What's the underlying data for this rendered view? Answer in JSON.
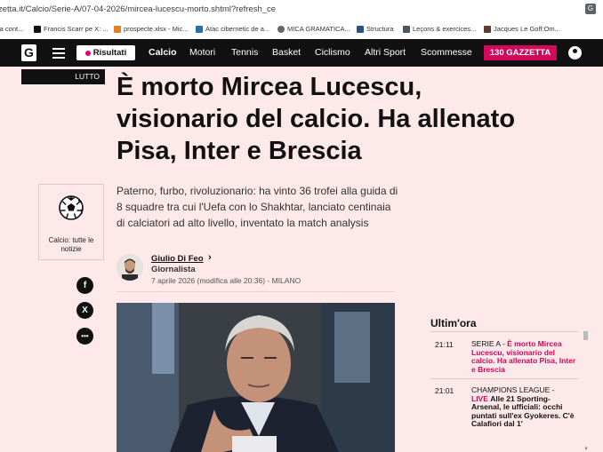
{
  "browser": {
    "url": "zetta.it/Calcio/Serie-A/07-04-2026/mircea-lucescu-morto.shtml?refresh_ce",
    "bookmarks": [
      {
        "label": "la cont...",
        "color": "#888"
      },
      {
        "label": "Francis Scarr pe X: ...",
        "color": "#111"
      },
      {
        "label": "prospecte.xlsx - Mic...",
        "color": "#1e7e34"
      },
      {
        "label": "Atac cibernetic de a...",
        "color": "#2b6cb0"
      },
      {
        "label": "MICA GRAMATICA...",
        "color": "#555"
      },
      {
        "label": "Structura",
        "color": "#2c5282"
      },
      {
        "label": "Leçons & exercices...",
        "color": "#4a5568"
      },
      {
        "label": "Jacques Le Goff:Om...",
        "color": "#5a3e2b"
      }
    ]
  },
  "nav": {
    "logo": "G",
    "risultati": "Risultati",
    "items": [
      "Calcio",
      "Motori",
      "Tennis",
      "Basket",
      "Ciclismo",
      "Altri Sport",
      "Scommesse"
    ],
    "gazzetta": "130 GAZZETTA"
  },
  "article": {
    "tag": "LUTTO",
    "headline": "È morto Mircea Lucescu, visionario del calcio. Ha allenato Pisa, Inter e Brescia",
    "summary": "Paterno, furbo, rivoluzionario: ha vinto 36 trofei alla guida di 8 squadre tra cui l'Uefa con lo Shakhtar, lanciato centinaia di calciatori ad alto livello, inventato la match analysis",
    "author": {
      "name": "Giulio Di Feo",
      "role": "Giornalista",
      "date": "7 aprile 2026 (modifica alle 20:36) - MILANO"
    }
  },
  "sidebar_card": {
    "label": "Calcio: tutte le notizie"
  },
  "social": [
    "f",
    "X",
    "•••"
  ],
  "ultimora": {
    "title": "Ultim'ora",
    "items": [
      {
        "time": "21:11",
        "section": "SERIE A - ",
        "headline": "È morto Mircea Lucescu, visionario del calcio. Ha allenato Pisa, Inter e Brescia"
      },
      {
        "time": "21:01",
        "section": "CHAMPIONS LEAGUE - ",
        "live": "LIVE",
        "headline": "Alle 21 Sporting-Arsenal, le ufficiali: occhi puntati sull'ex Gyokeres. C'è Calafiori dal 1'"
      }
    ]
  }
}
